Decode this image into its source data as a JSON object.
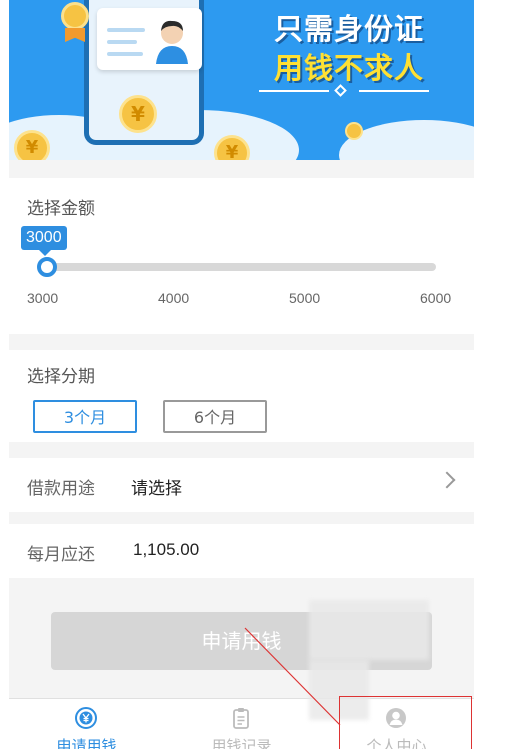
{
  "banner": {
    "slogan_line1": "只需身份证",
    "slogan_line2": "用钱不求人",
    "coin_symbol": "¥",
    "colors": {
      "sky": "#2d9af0",
      "slogan_accent": "#ffe033"
    }
  },
  "amount": {
    "title": "选择金额",
    "selected_value": "3000",
    "slider_fraction": 0.0,
    "ticks": [
      "3000",
      "4000",
      "5000",
      "6000"
    ]
  },
  "term": {
    "title": "选择分期",
    "options": [
      {
        "label": "3个月",
        "selected": true
      },
      {
        "label": "6个月",
        "selected": false
      }
    ]
  },
  "purpose": {
    "label": "借款用途",
    "value": "请选择"
  },
  "monthly": {
    "label": "每月应还",
    "value": "1,105.00"
  },
  "apply_button": {
    "label": "申请用钱"
  },
  "tabbar": {
    "tabs": [
      {
        "label": "申请用钱",
        "icon": "yen-coin-icon",
        "active": true
      },
      {
        "label": "用钱记录",
        "icon": "clipboard-icon",
        "active": false
      },
      {
        "label": "个人中心",
        "icon": "user-avatar-icon",
        "active": false
      }
    ],
    "accent_color": "#2e8ee0"
  }
}
